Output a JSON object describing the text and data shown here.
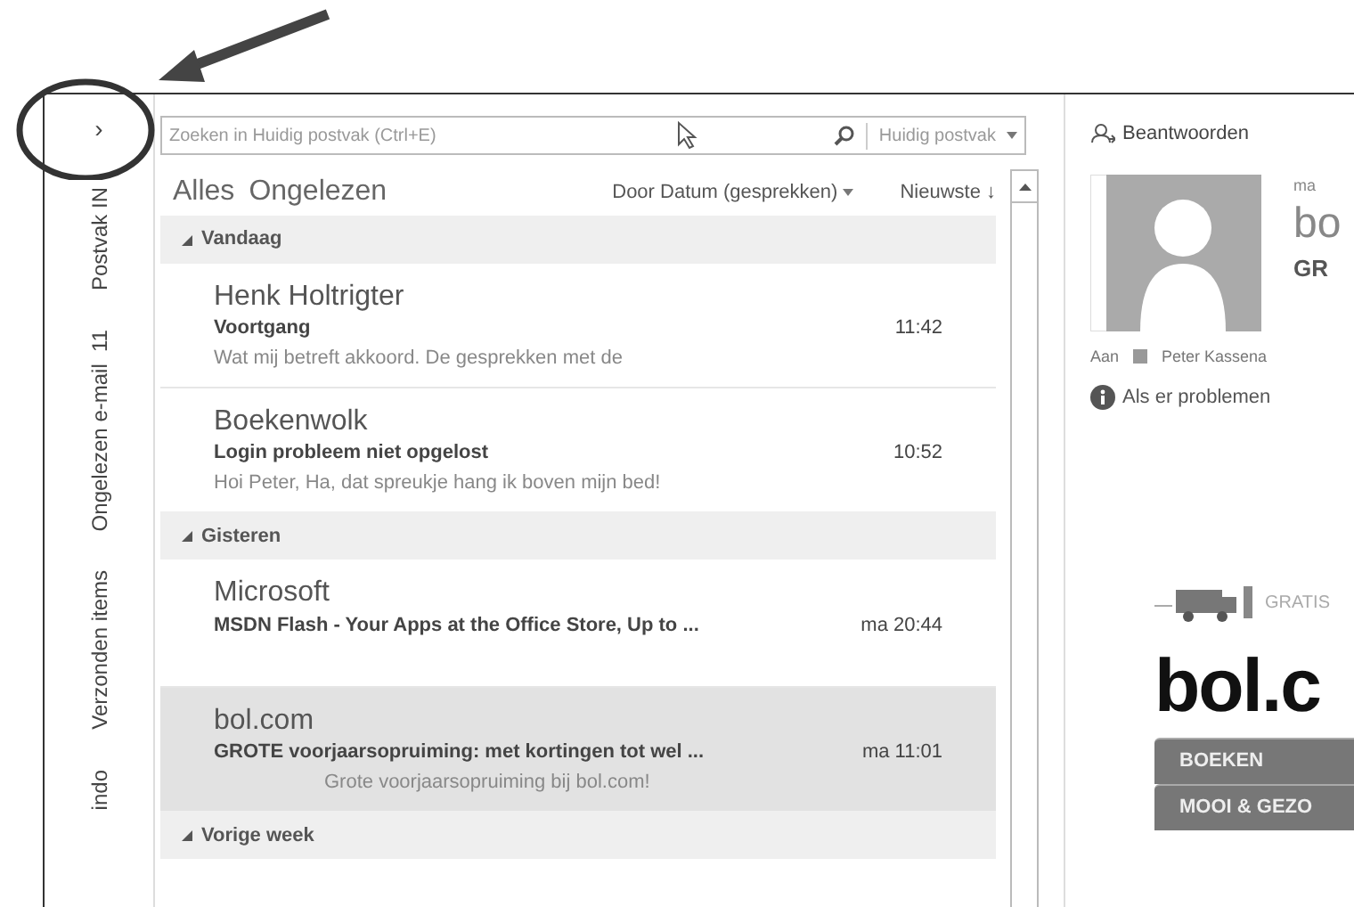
{
  "nav": {
    "expand_glyph": "›",
    "folders": [
      {
        "label": "Postvak IN"
      },
      {
        "label": "Ongelezen e-mail",
        "count": "11"
      },
      {
        "label": "Verzonden items"
      },
      {
        "label": "indo"
      }
    ]
  },
  "search": {
    "placeholder": "Zoeken in Huidig postvak (Ctrl+E)",
    "scope": "Huidig postvak"
  },
  "filters": [
    {
      "label": "Alles"
    },
    {
      "label": "Ongelezen"
    }
  ],
  "sort": {
    "label": "Door Datum (gesprekken)",
    "order": "Nieuwste",
    "order_arrow": "↓"
  },
  "groups": [
    {
      "label": "Vandaag",
      "expanded": true,
      "messages": [
        {
          "sender": "Henk Holtrigter",
          "subject": "Voortgang",
          "preview": "Wat mij betreft akkoord. De gesprekken met de",
          "time": "11:42",
          "selected": false
        },
        {
          "sender": "Boekenwolk",
          "subject": "Login probleem niet opgelost",
          "preview": "Hoi Peter,  Ha, dat spreukje hang ik boven mijn bed!",
          "time": "10:52",
          "selected": false
        }
      ]
    },
    {
      "label": "Gisteren",
      "expanded": true,
      "messages": [
        {
          "sender": "Microsoft",
          "subject": "MSDN Flash - Your Apps at the Office Store, Up to ...",
          "time": "ma 20:44",
          "selected": false
        },
        {
          "sender": "bol.com",
          "subject": "GROTE voorjaarsopruiming: met kortingen tot wel ...",
          "preview": "Grote voorjaarsopruiming bij bol.com!",
          "time": "ma 11:01",
          "selected": true
        }
      ]
    },
    {
      "label": "Vorige week",
      "expanded": true
    }
  ],
  "reading_pane": {
    "reply": "Beantwoorden",
    "date": "ma",
    "sender": "bo",
    "subject": "GR",
    "to_label": "Aan",
    "recipient": "Peter Kassena",
    "info": "Als er problemen",
    "banner": {
      "shipping": "GRATIS",
      "logo": "bol.c",
      "categories": [
        "BOEKEN",
        "MOOI & GEZO"
      ]
    }
  }
}
